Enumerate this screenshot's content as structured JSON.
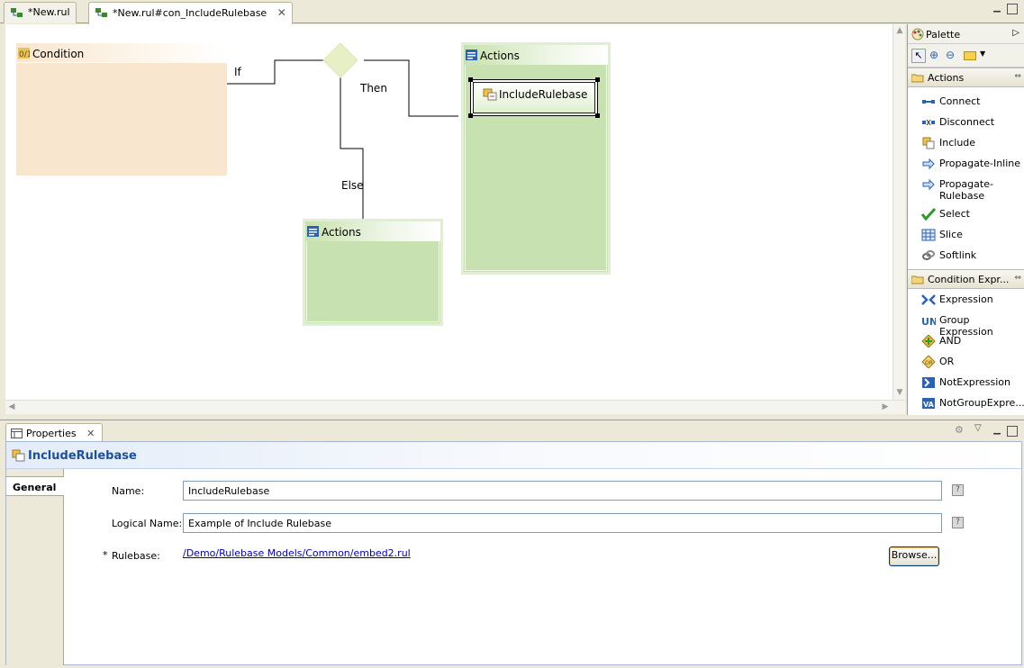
{
  "editor": {
    "tabs": [
      {
        "label": "*New.rul",
        "active": false
      },
      {
        "label": "*New.rul#con_IncludeRulebase",
        "active": true
      }
    ]
  },
  "diagram": {
    "condition_label": "Condition",
    "if_label": "If",
    "then_label": "Then",
    "else_label": "Else",
    "then_actions_label": "Actions",
    "else_actions_label": "Actions",
    "include_node_label": "IncludeRulebase"
  },
  "palette": {
    "title": "Palette",
    "drawers": [
      {
        "label": "Actions",
        "items": [
          {
            "label": "Connect",
            "icon": "connect-icon"
          },
          {
            "label": "Disconnect",
            "icon": "disconnect-icon"
          },
          {
            "label": "Include",
            "icon": "include-icon"
          },
          {
            "label": "Propagate-Inline",
            "icon": "propagate-icon"
          },
          {
            "label": "Propagate-Rulebase",
            "icon": "propagate-icon"
          },
          {
            "label": "Select",
            "icon": "checkmark-icon"
          },
          {
            "label": "Slice",
            "icon": "grid-icon"
          },
          {
            "label": "Softlink",
            "icon": "link-icon"
          }
        ]
      },
      {
        "label": "Condition Expr...",
        "items": [
          {
            "label": "Expression",
            "icon": "expression-icon"
          },
          {
            "label": "Group Expression",
            "icon": "group-expression-icon"
          },
          {
            "label": "AND",
            "icon": "and-icon"
          },
          {
            "label": "OR",
            "icon": "or-icon"
          },
          {
            "label": "NotExpression",
            "icon": "not-expression-icon"
          },
          {
            "label": "NotGroupExpre...",
            "icon": "not-group-expression-icon"
          }
        ]
      }
    ]
  },
  "properties": {
    "tab_label": "Properties",
    "title": "IncludeRulebase",
    "side_tab": "General",
    "fields": {
      "name_label": "Name:",
      "name_value": "IncludeRulebase",
      "logical_name_label": "Logical Name:",
      "logical_name_value": "Example of Include Rulebase",
      "required_mark": "*",
      "rulebase_label": "Rulebase:",
      "rulebase_value": "/Demo/Rulebase Models/Common/embed2.rul",
      "browse_label": "Browse...",
      "help": "?"
    }
  },
  "colors": {
    "condition_fill": "#f8e6cf",
    "actions_fill": "#c8e1b0",
    "diamond_fill": "#e6f0c4",
    "title_blue": "#1c4f9c",
    "link_blue": "#0000c0"
  }
}
